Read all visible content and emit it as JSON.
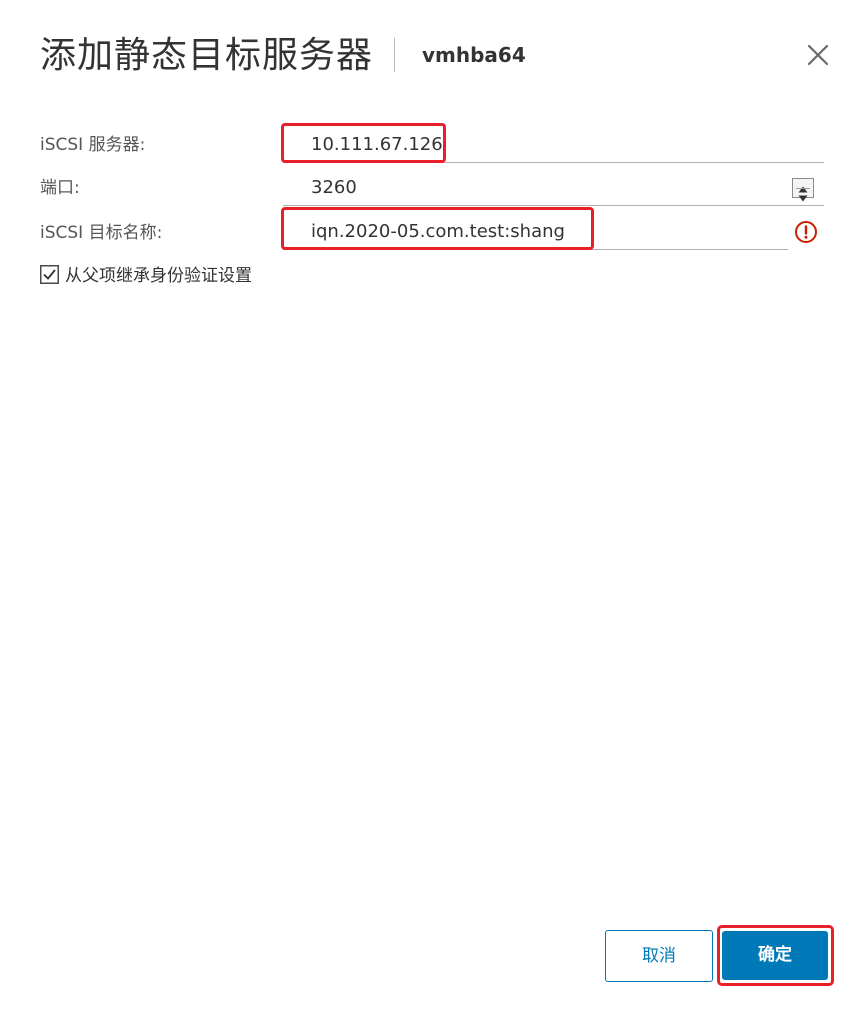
{
  "dialog": {
    "title": "添加静态目标服务器",
    "subtitle": "vmhba64",
    "close_icon": "close-icon"
  },
  "fields": {
    "server": {
      "label": "iSCSI 服务器:",
      "value": "10.111.67.126"
    },
    "port": {
      "label": "端口:",
      "value": "3260",
      "spinner_icon": "spinner-arrows-icon"
    },
    "target_name": {
      "label": "iSCSI 目标名称:",
      "value": "iqn.2020-05.com.test:shang",
      "error_icon": "error-circle-icon"
    }
  },
  "inherit_auth": {
    "label": "从父项继承身份验证设置",
    "checked": true
  },
  "buttons": {
    "cancel": "取消",
    "ok": "确定"
  },
  "colors": {
    "primary": "#0079b8",
    "highlight": "#e8202a",
    "error": "#c92100"
  }
}
